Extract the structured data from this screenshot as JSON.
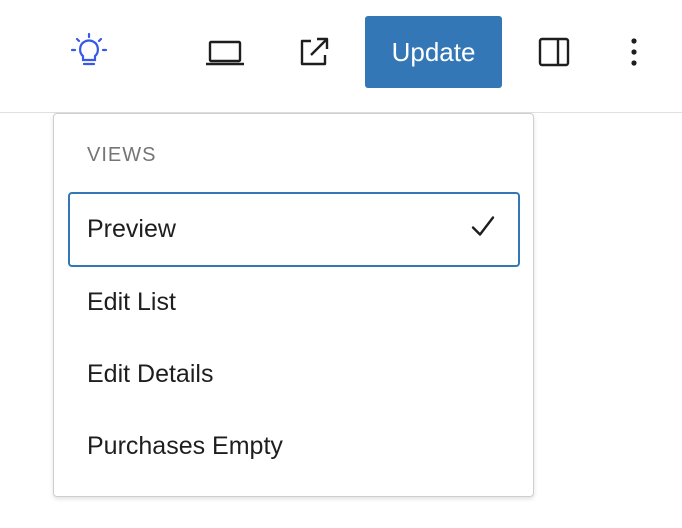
{
  "toolbar": {
    "icons": [
      {
        "name": "lightbulb-icon",
        "color": "#3858e9"
      },
      {
        "name": "laptop-icon"
      },
      {
        "name": "external-link-icon"
      },
      {
        "name": "sidebar-toggle-icon"
      },
      {
        "name": "more-options-icon"
      }
    ],
    "update_label": "Update",
    "accent_color": "#3477b7"
  },
  "views_menu": {
    "group_title": "VIEWS",
    "items": [
      {
        "label": "Preview",
        "selected": true
      },
      {
        "label": "Edit List",
        "selected": false
      },
      {
        "label": "Edit Details",
        "selected": false
      },
      {
        "label": "Purchases Empty",
        "selected": false
      }
    ]
  }
}
